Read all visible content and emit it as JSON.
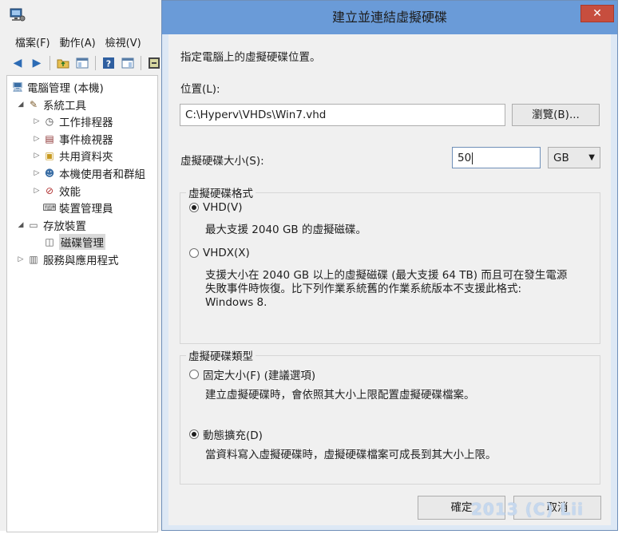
{
  "mmc": {
    "menu": [
      "檔案(F)",
      "動作(A)",
      "檢視(V)"
    ],
    "toolbar_icons": [
      "back-arrow-icon",
      "forward-arrow-icon",
      "up-folder-icon",
      "show-hide-tree-icon",
      "help-icon",
      "properties-icon",
      "export-icon"
    ],
    "tree": [
      {
        "label": "電腦管理 (本機)",
        "icon": "computer-management-icon",
        "expander": "none",
        "level": 0
      },
      {
        "label": "系統工具",
        "icon": "tools-icon",
        "expander": "expanded",
        "level": 1
      },
      {
        "label": "工作排程器",
        "icon": "clock-icon",
        "expander": "collapsed",
        "level": 2
      },
      {
        "label": "事件檢視器",
        "icon": "event-viewer-icon",
        "expander": "collapsed",
        "level": 2
      },
      {
        "label": "共用資料夾",
        "icon": "shared-folder-icon",
        "expander": "collapsed",
        "level": 2
      },
      {
        "label": "本機使用者和群組",
        "icon": "users-icon",
        "expander": "collapsed",
        "level": 2
      },
      {
        "label": "效能",
        "icon": "performance-icon",
        "expander": "collapsed",
        "level": 2
      },
      {
        "label": "裝置管理員",
        "icon": "device-manager-icon",
        "expander": "none",
        "level": 2
      },
      {
        "label": "存放裝置",
        "icon": "storage-icon",
        "expander": "expanded",
        "level": 1
      },
      {
        "label": "磁碟管理",
        "icon": "disk-management-icon",
        "expander": "none",
        "level": 2,
        "selected": true
      },
      {
        "label": "服務與應用程式",
        "icon": "services-icon",
        "expander": "collapsed",
        "level": 1
      }
    ]
  },
  "dialog": {
    "title": "建立並連結虛擬硬碟",
    "close_icon": "close-icon",
    "instruction": "指定電腦上的虛擬硬碟位置。",
    "location_label": "位置(L):",
    "location_value": "C:\\Hyperv\\VHDs\\Win7.vhd",
    "browse_label": "瀏覽(B)...",
    "size_label": "虛擬硬碟大小(S):",
    "size_value": "50",
    "size_unit": "GB",
    "format_group": {
      "legend": "虛擬硬碟格式",
      "options": [
        {
          "label": "VHD(V)",
          "selected": true,
          "description": [
            "最大支援 2040 GB 的虛擬磁碟。"
          ]
        },
        {
          "label": "VHDX(X)",
          "selected": false,
          "description": [
            "支援大小在 2040 GB 以上的虛擬磁碟 (最大支援 64 TB) 而且可在發生電源",
            "失敗事件時恢復。比下列作業系統舊的作業系統版本不支援此格式:",
            "Windows 8."
          ]
        }
      ]
    },
    "type_group": {
      "legend": "虛擬硬碟類型",
      "options": [
        {
          "label": "固定大小(F) (建議選項)",
          "selected": false,
          "description": [
            "建立虛擬硬碟時，會依照其大小上限配置虛擬硬碟檔案。"
          ]
        },
        {
          "label": "動態擴充(D)",
          "selected": true,
          "description": [
            "當資料寫入虛擬硬碟時，虛擬硬碟檔案可成長到其大小上限。"
          ]
        }
      ]
    },
    "ok_label": "確定",
    "cancel_label": "取消"
  },
  "watermark": "2013 (C) Lii",
  "colors": {
    "title_bar": "#6a9bd8",
    "close_button": "#c74e3e",
    "dialog_body": "#f0f0f0"
  }
}
